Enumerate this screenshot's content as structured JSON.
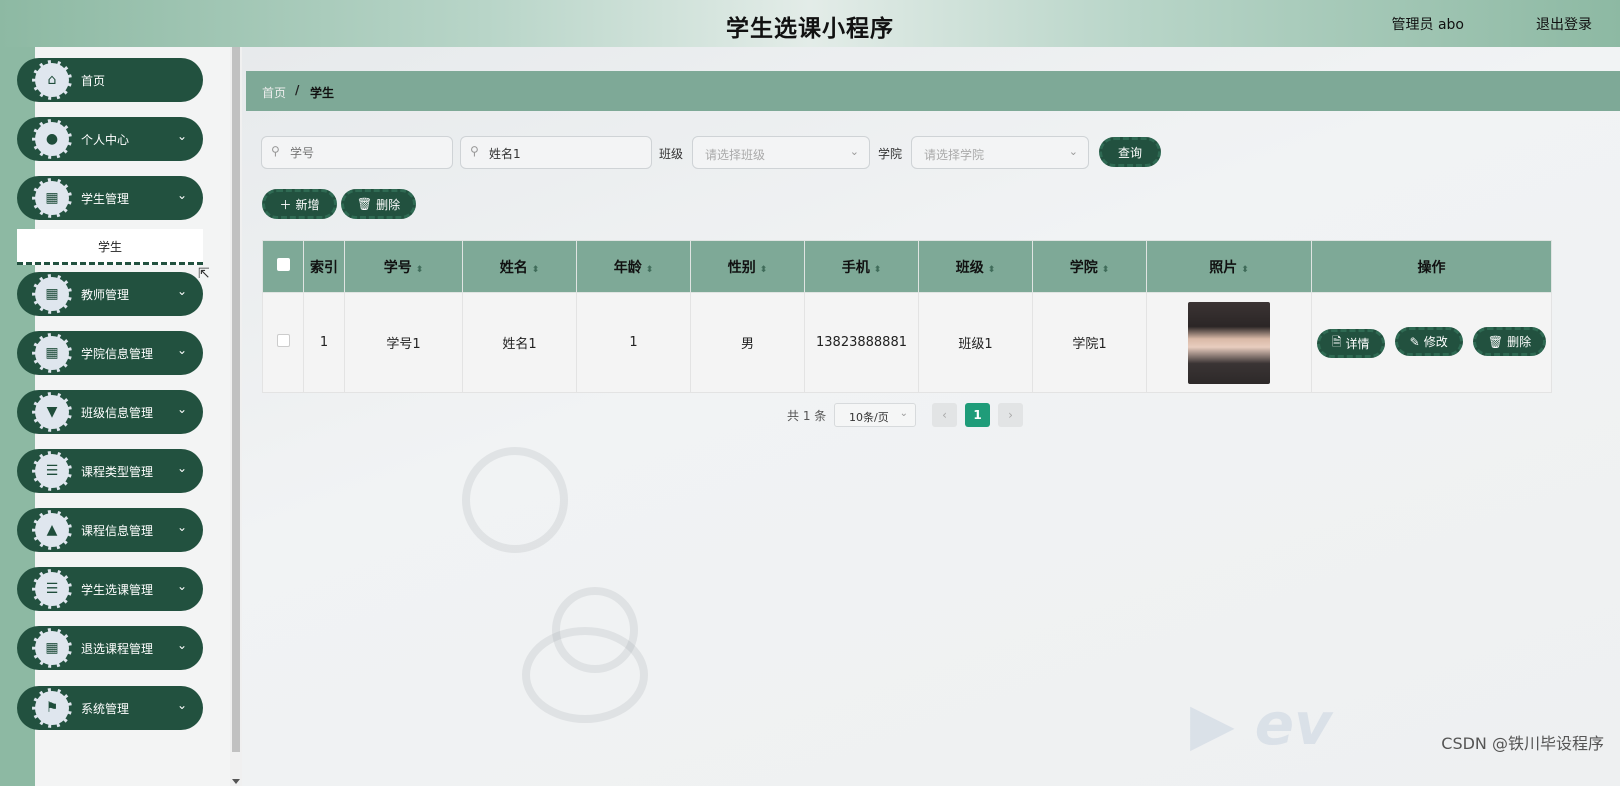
{
  "header": {
    "title": "学生选课小程序",
    "user": "管理员 abo",
    "logout": "退出登录"
  },
  "sidebar": {
    "items": [
      {
        "label": "首页",
        "icon": "home-icon",
        "glyph": "⌂",
        "chevron": ""
      },
      {
        "label": "个人中心",
        "icon": "user-icon",
        "glyph": "●",
        "chevron": "⌄"
      },
      {
        "label": "学生管理",
        "icon": "grid-icon",
        "glyph": "▦",
        "chevron": "⌄"
      },
      {
        "label": "教师管理",
        "icon": "grid-icon",
        "glyph": "▦",
        "chevron": "⌄"
      },
      {
        "label": "学院信息管理",
        "icon": "grid-icon",
        "glyph": "▦",
        "chevron": "⌄"
      },
      {
        "label": "班级信息管理",
        "icon": "pin-icon",
        "glyph": "▼",
        "chevron": "⌄"
      },
      {
        "label": "课程类型管理",
        "icon": "list-icon",
        "glyph": "☰",
        "chevron": "⌄"
      },
      {
        "label": "课程信息管理",
        "icon": "stamp-icon",
        "glyph": "▲",
        "chevron": "⌄"
      },
      {
        "label": "学生选课管理",
        "icon": "list-icon",
        "glyph": "☰",
        "chevron": "⌄"
      },
      {
        "label": "退选课程管理",
        "icon": "grid-icon",
        "glyph": "▦",
        "chevron": "⌄"
      },
      {
        "label": "系统管理",
        "icon": "flag-icon",
        "glyph": "⚑",
        "chevron": "⌄"
      }
    ],
    "submenu": {
      "label": "学生"
    }
  },
  "breadcrumb": {
    "home": "首页",
    "sep": "/",
    "current": "学生"
  },
  "search": {
    "student_no": {
      "value": "",
      "placeholder": "学号"
    },
    "name": {
      "value": "姓名1",
      "placeholder": "姓名"
    },
    "class_label": "班级",
    "class_placeholder": "请选择班级",
    "college_label": "学院",
    "college_placeholder": "请选择学院",
    "query_button": "查询"
  },
  "toolbar": {
    "add": "新增",
    "delete": "删除"
  },
  "table": {
    "headers": [
      "索引",
      "学号",
      "姓名",
      "年龄",
      "性别",
      "手机",
      "班级",
      "学院",
      "照片",
      "操作"
    ],
    "rows": [
      {
        "index": "1",
        "student_no": "学号1",
        "name": "姓名1",
        "age": "1",
        "gender": "男",
        "phone": "13823888881",
        "class": "班级1",
        "college": "学院1"
      }
    ],
    "actions": {
      "detail": "详情",
      "edit": "修改",
      "delete": "删除"
    }
  },
  "pagination": {
    "total": "共 1 条",
    "page_size": "10条/页",
    "current": "1"
  },
  "watermark": "CSDN @铁川毕设程序",
  "colors": {
    "primary": "#22513f",
    "header_bg": "#7ea997",
    "page_active": "#1f9c79"
  }
}
